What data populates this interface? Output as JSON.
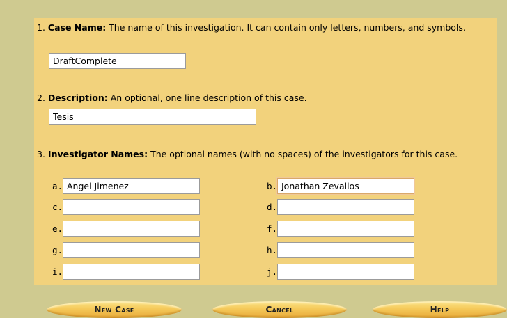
{
  "case_name": {
    "number": "1.",
    "label": "Case Name:",
    "text": " The name of this investigation. It can contain only letters, numbers, and symbols.",
    "value": "DraftComplete"
  },
  "description": {
    "number": "2.",
    "label": "Description:",
    "text": " An optional, one line description of this case.",
    "value": "Tesis"
  },
  "investigators": {
    "number": "3.",
    "label": "Investigator Names:",
    "text": " The optional names (with no spaces) of the investigators for this case.",
    "fields": [
      {
        "letter": "a.",
        "value": "Angel Jimenez"
      },
      {
        "letter": "b.",
        "value": "Jonathan Zevallos"
      },
      {
        "letter": "c.",
        "value": ""
      },
      {
        "letter": "d.",
        "value": ""
      },
      {
        "letter": "e.",
        "value": ""
      },
      {
        "letter": "f.",
        "value": ""
      },
      {
        "letter": "g.",
        "value": ""
      },
      {
        "letter": "h.",
        "value": ""
      },
      {
        "letter": "i.",
        "value": ""
      },
      {
        "letter": "j.",
        "value": ""
      }
    ]
  },
  "buttons": {
    "new_case": "New Case",
    "cancel": "Cancel",
    "help": "Help"
  },
  "colors": {
    "background": "#cfca90",
    "panel": "#f2d27c",
    "button": "#f5c95a"
  }
}
